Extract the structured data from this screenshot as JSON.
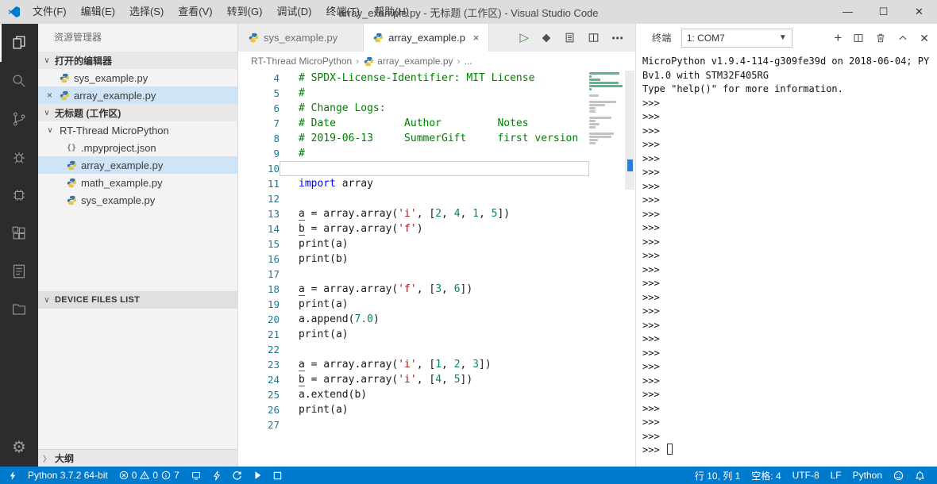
{
  "window": {
    "menus": [
      "文件(F)",
      "编辑(E)",
      "选择(S)",
      "查看(V)",
      "转到(G)",
      "调试(D)",
      "终端(T)",
      "帮助(H)"
    ],
    "title": "array_example.py - 无标题 (工作区) - Visual Studio Code",
    "controls": {
      "minimize": "—",
      "maximize": "☐",
      "close": "✕"
    }
  },
  "sidebar": {
    "title": "资源管理器",
    "open_editors_label": "打开的编辑器",
    "open_editors": [
      {
        "label": "sys_example.py",
        "close": "",
        "active": false
      },
      {
        "label": "array_example.py",
        "close": "×",
        "active": true
      }
    ],
    "workspace_label": "无标题 (工作区)",
    "tree": [
      {
        "label": "RT-Thread MicroPython",
        "type": "folder",
        "level": 0,
        "selected": false
      },
      {
        "label": ".mpyproject.json",
        "type": "json",
        "level": 1,
        "selected": false
      },
      {
        "label": "array_example.py",
        "type": "python",
        "level": 1,
        "selected": true
      },
      {
        "label": "math_example.py",
        "type": "python",
        "level": 1,
        "selected": false
      },
      {
        "label": "sys_example.py",
        "type": "python",
        "level": 1,
        "selected": false
      }
    ],
    "device_section_label": "DEVICE FILES LIST",
    "outline_label": "大纲"
  },
  "editor": {
    "tabs": [
      {
        "label": "sys_example.py",
        "active": false,
        "close": ""
      },
      {
        "label": "array_example.py",
        "active": true,
        "close": "×"
      }
    ],
    "breadcrumb": [
      "RT-Thread MicroPython",
      "array_example.py",
      "..."
    ],
    "current_line": 10,
    "lines": [
      {
        "n": 4,
        "tokens": [
          [
            "# SPDX-License-Identifier: MIT License",
            "comment"
          ]
        ]
      },
      {
        "n": 5,
        "tokens": [
          [
            "#",
            "comment"
          ]
        ]
      },
      {
        "n": 6,
        "tokens": [
          [
            "# Change Logs:",
            "comment"
          ]
        ]
      },
      {
        "n": 7,
        "tokens": [
          [
            "# Date           Author         Notes",
            "comment"
          ]
        ]
      },
      {
        "n": 8,
        "tokens": [
          [
            "# 2019-06-13     SummerGift     first version",
            "comment"
          ]
        ]
      },
      {
        "n": 9,
        "tokens": [
          [
            "#",
            "comment"
          ]
        ]
      },
      {
        "n": 10,
        "tokens": []
      },
      {
        "n": 11,
        "tokens": [
          [
            "import",
            "kw"
          ],
          [
            " array",
            "plain"
          ]
        ]
      },
      {
        "n": 12,
        "tokens": []
      },
      {
        "n": 13,
        "tokens": [
          [
            "a",
            "plain u"
          ],
          [
            " = array.array(",
            "plain"
          ],
          [
            "'i'",
            "str"
          ],
          [
            ", [",
            "plain"
          ],
          [
            "2",
            "num"
          ],
          [
            ", ",
            "plain"
          ],
          [
            "4",
            "num"
          ],
          [
            ", ",
            "plain"
          ],
          [
            "1",
            "num"
          ],
          [
            ", ",
            "plain"
          ],
          [
            "5",
            "num"
          ],
          [
            "])",
            "plain"
          ]
        ]
      },
      {
        "n": 14,
        "tokens": [
          [
            "b",
            "plain u"
          ],
          [
            " = array.array(",
            "plain"
          ],
          [
            "'f'",
            "str"
          ],
          [
            ")",
            "plain"
          ]
        ]
      },
      {
        "n": 15,
        "tokens": [
          [
            "print(a)",
            "plain"
          ]
        ]
      },
      {
        "n": 16,
        "tokens": [
          [
            "print(b)",
            "plain"
          ]
        ]
      },
      {
        "n": 17,
        "tokens": []
      },
      {
        "n": 18,
        "tokens": [
          [
            "a",
            "plain u"
          ],
          [
            " = array.array(",
            "plain"
          ],
          [
            "'f'",
            "str"
          ],
          [
            ", [",
            "plain"
          ],
          [
            "3",
            "num"
          ],
          [
            ", ",
            "plain"
          ],
          [
            "6",
            "num"
          ],
          [
            "])",
            "plain"
          ]
        ]
      },
      {
        "n": 19,
        "tokens": [
          [
            "print(a)",
            "plain"
          ]
        ]
      },
      {
        "n": 20,
        "tokens": [
          [
            "a.append(",
            "plain"
          ],
          [
            "7.0",
            "num"
          ],
          [
            ")",
            "plain"
          ]
        ]
      },
      {
        "n": 21,
        "tokens": [
          [
            "print(a)",
            "plain"
          ]
        ]
      },
      {
        "n": 22,
        "tokens": []
      },
      {
        "n": 23,
        "tokens": [
          [
            "a",
            "plain u"
          ],
          [
            " = array.array(",
            "plain"
          ],
          [
            "'i'",
            "str"
          ],
          [
            ", [",
            "plain"
          ],
          [
            "1",
            "num"
          ],
          [
            ", ",
            "plain"
          ],
          [
            "2",
            "num"
          ],
          [
            ", ",
            "plain"
          ],
          [
            "3",
            "num"
          ],
          [
            "])",
            "plain"
          ]
        ]
      },
      {
        "n": 24,
        "tokens": [
          [
            "b",
            "plain u"
          ],
          [
            " = array.array(",
            "plain"
          ],
          [
            "'i'",
            "str"
          ],
          [
            ", [",
            "plain"
          ],
          [
            "4",
            "num"
          ],
          [
            ", ",
            "plain"
          ],
          [
            "5",
            "num"
          ],
          [
            "])",
            "plain"
          ]
        ]
      },
      {
        "n": 25,
        "tokens": [
          [
            "a.extend(b)",
            "plain"
          ]
        ]
      },
      {
        "n": 26,
        "tokens": [
          [
            "print(a)",
            "plain"
          ]
        ]
      },
      {
        "n": 27,
        "tokens": []
      }
    ]
  },
  "terminal": {
    "title": "终端",
    "selector_value": "1: COM7",
    "banner": [
      "MicroPython v1.9.4-114-g309fe39d on 2018-06-04; PY",
      "Bv1.0 with STM32F405RG",
      "Type \"help()\" for more information."
    ],
    "prompt": ">>>",
    "prompt_count": 25
  },
  "statusbar": {
    "interpreter": "Python 3.7.2 64-bit",
    "errors": "0",
    "warnings": "0",
    "infos": "7",
    "line_col": "行 10, 列 1",
    "spaces": "空格: 4",
    "encoding": "UTF-8",
    "eol": "LF",
    "language": "Python"
  },
  "colors": {
    "statusbar_bg": "#007acc",
    "activitybar_bg": "#2c2c2c",
    "selection_bg": "#cfe4f6",
    "comment": "#008000",
    "keyword": "#0000ff",
    "string": "#a31515",
    "number": "#098658"
  }
}
